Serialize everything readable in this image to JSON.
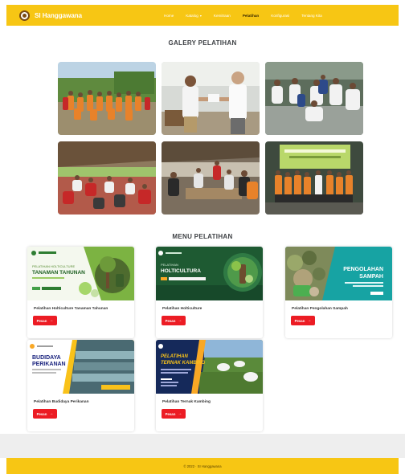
{
  "navbar": {
    "brand": "SI Hanggawana",
    "links": [
      {
        "label": "Home"
      },
      {
        "label": "Katalog"
      },
      {
        "label": "Kemitraan"
      },
      {
        "label": "Pelatihan"
      },
      {
        "label": "Konfigurasi"
      },
      {
        "label": "Tentang Kita"
      }
    ],
    "active_link": "Pelatihan",
    "bg_color": "#f7c614"
  },
  "gallery": {
    "title": "GALERY PELATIHAN"
  },
  "menu": {
    "title": "MENU PELATIHAN",
    "button_label": "Pesan",
    "button_color": "#ec1c24",
    "cards": [
      {
        "title": "Pelatihan Holticulture Tanaman Tahunan",
        "banner": {
          "small": "PELATIHAN HOLTICULTURE",
          "big": "TANAMAN TAHUNAN"
        }
      },
      {
        "title": "Pelatihan Holticulture",
        "banner": {
          "small": "PELATIHAN",
          "big": "HOLTICULTURA"
        }
      },
      {
        "title": "Pelatihan Pengolahan Sampah",
        "banner": {
          "big_1": "PENGOLAHAN",
          "big_2": "SAMPAH"
        }
      },
      {
        "title": "Pelatihan Budidaya Perikanan",
        "banner": {
          "big_1": "BUDIDAYA",
          "big_2": "PERIKANAN"
        }
      },
      {
        "title": "Pelatihan Ternak Kambing",
        "banner": {
          "big_1": "PELATIHAN",
          "big_2": "TERNAK KAMBING"
        }
      }
    ]
  },
  "footer": {
    "text": "© 2022 · SI Hanggawana"
  }
}
